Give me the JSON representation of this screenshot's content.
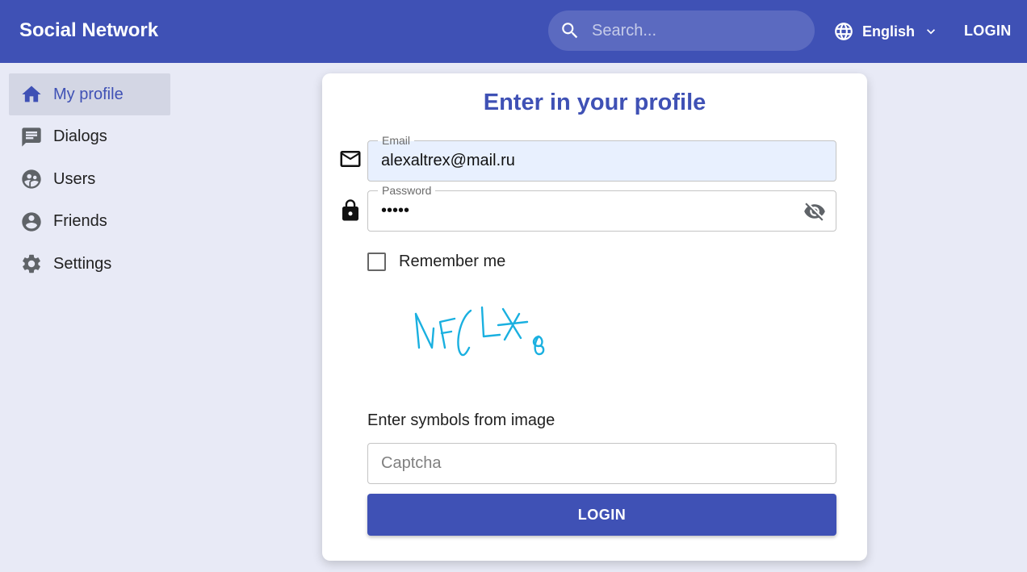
{
  "header": {
    "brand": "Social Network",
    "search_placeholder": "Search...",
    "language": "English",
    "login_label": "LOGIN"
  },
  "sidebar": {
    "items": [
      {
        "label": "My profile",
        "icon": "home-icon",
        "active": true
      },
      {
        "label": "Dialogs",
        "icon": "chat-icon"
      },
      {
        "label": "Users",
        "icon": "users-icon"
      },
      {
        "label": "Friends",
        "icon": "account-circle-icon"
      },
      {
        "label": "Settings",
        "icon": "gear-icon"
      }
    ]
  },
  "login_form": {
    "title": "Enter in your profile",
    "email_label": "Email",
    "email_value": "alexaltrex@mail.ru",
    "password_label": "Password",
    "password_value": "•••••",
    "remember_label": "Remember me",
    "remember_checked": false,
    "captcha_text": "NFCLX8",
    "captcha_instruction": "Enter symbols from image",
    "captcha_placeholder": "Captcha",
    "submit_label": "LOGIN"
  },
  "colors": {
    "primary": "#3f51b5",
    "background": "#e8eaf6",
    "captcha_ink": "#1ab0e0"
  }
}
